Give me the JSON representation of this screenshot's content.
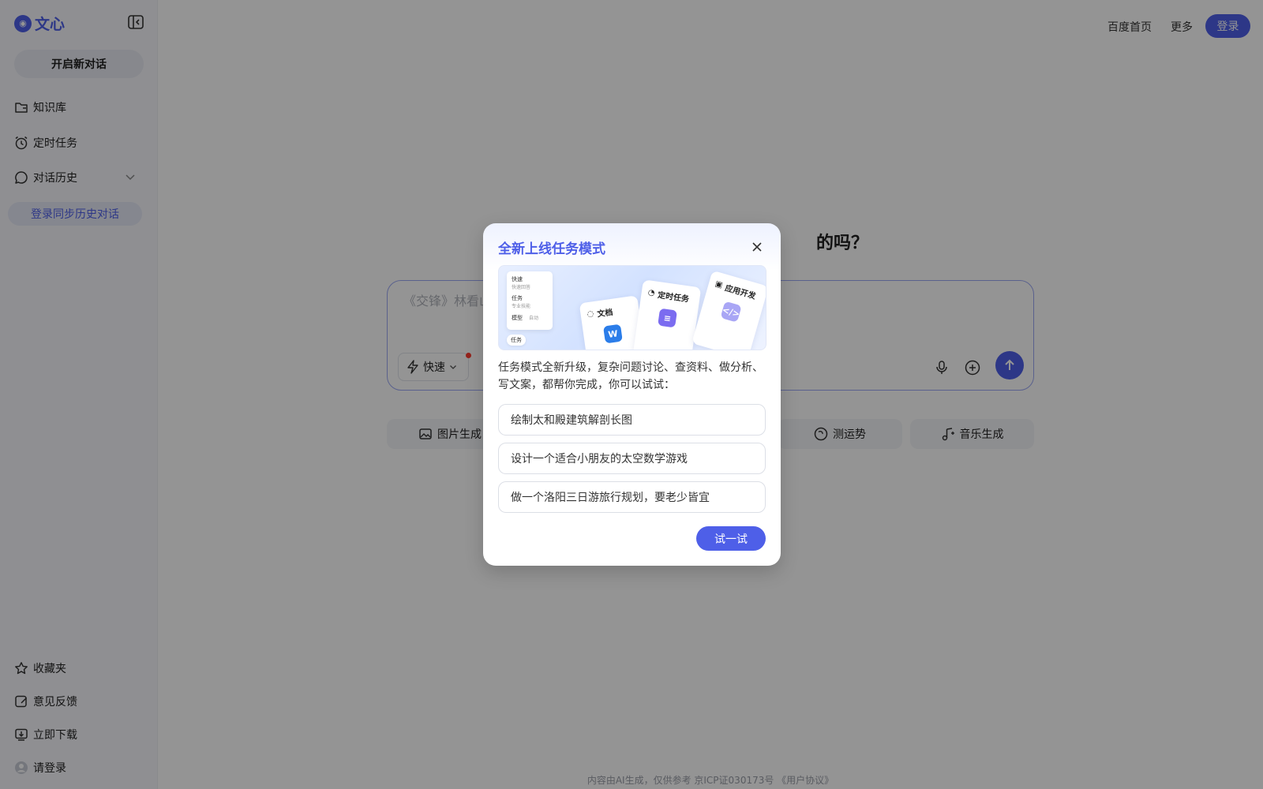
{
  "app": {
    "logo_text": "文心",
    "accent_color": "#4e5fe8"
  },
  "sidebar": {
    "new_chat_label": "开启新对话",
    "items": [
      {
        "label": "知识库",
        "icon": "folder-icon"
      },
      {
        "label": "定时任务",
        "icon": "alarm-clock-icon"
      },
      {
        "label": "对话历史",
        "icon": "chat-bubble-icon"
      }
    ],
    "sync_history_label": "登录同步历史对话",
    "bottom_items": [
      {
        "label": "收藏夹",
        "icon": "star-icon"
      },
      {
        "label": "意见反馈",
        "icon": "feedback-edit-icon"
      },
      {
        "label": "立即下载",
        "icon": "download-icon"
      },
      {
        "label": "请登录",
        "icon": "avatar-icon"
      }
    ]
  },
  "header": {
    "home_link": "百度首页",
    "more_link": "更多",
    "login_label": "登录"
  },
  "main": {
    "greeting_visible": "的吗？",
    "input_placeholder_visible": "《交锋》林看山",
    "mode_label": "快速",
    "chips": [
      {
        "label": "图片生成",
        "icon": "image-icon"
      },
      {
        "label": "测运势",
        "icon": "fortune-icon"
      },
      {
        "label": "音乐生成",
        "icon": "music-note-icon"
      }
    ],
    "footer": "内容由AI生成，仅供参考  京ICP证030173号  《用户协议》"
  },
  "modal": {
    "title": "全新上线任务模式",
    "banner": {
      "menu_fast": "快速",
      "menu_fast_sub": "快速回答",
      "menu_task": "任务",
      "menu_task_sub": "专业技能",
      "menu_other": "模型",
      "menu_other_sub": "自动",
      "pill_label": "任务",
      "card_docs": "文档",
      "card_schedule": "定时任务",
      "card_dev": "应用开发"
    },
    "description": "任务模式全新升级，复杂问题讨论、查资料、做分析、写文案，都帮你完成，你可以试试：",
    "suggestions": [
      "绘制太和殿建筑解剖长图",
      "设计一个适合小朋友的太空数学游戏",
      "做一个洛阳三日游旅行规划，要老少皆宜"
    ],
    "try_label": "试一试"
  }
}
